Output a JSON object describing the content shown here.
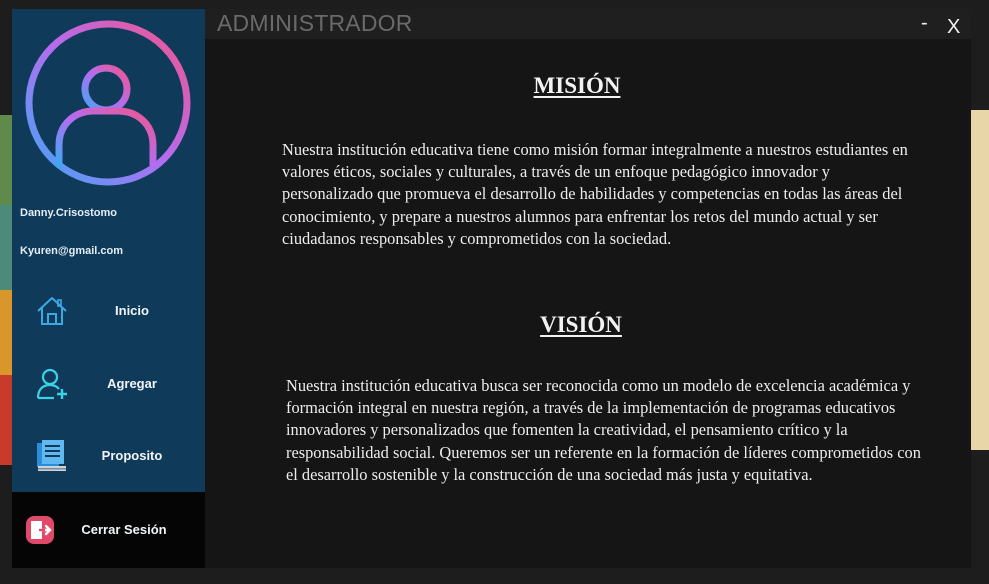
{
  "window": {
    "title": "ADMINISTRADOR",
    "minimize_label": "-",
    "close_label": "X"
  },
  "user": {
    "name": "Danny.Crisostomo",
    "email": "Kyuren@gmail.com"
  },
  "nav": {
    "items": [
      {
        "label": "Inicio",
        "icon": "home-icon"
      },
      {
        "label": "Agregar",
        "icon": "add-user-icon"
      },
      {
        "label": "Proposito",
        "icon": "document-icon"
      }
    ],
    "logout": {
      "label": "Cerrar Sesión",
      "icon": "logout-icon"
    }
  },
  "content": {
    "mision_title": "MISIÓN",
    "mision_text": "Nuestra institución educativa tiene como misión formar integralmente a nuestros estudiantes en valores éticos, sociales y culturales, a través de un enfoque pedagógico innovador y personalizado que promueva el desarrollo de habilidades y competencias en todas las áreas del conocimiento, y prepare a nuestros alumnos para enfrentar los retos del mundo actual y ser ciudadanos responsables y comprometidos con la sociedad.",
    "vision_title": "VISIÓN",
    "vision_text": "Nuestra institución educativa busca ser reconocida como un modelo de excelencia académica y formación integral en nuestra región, a través de la implementación de programas educativos innovadores y personalizados que fomenten la creatividad, el pensamiento crítico y la responsabilidad social. Queremos ser un referente en la formación de líderes comprometidos con el desarrollo sostenible y la construcción de una sociedad más justa y equitativa."
  },
  "colors": {
    "sidebar": "#0f3a5a",
    "logout_bg": "#050505",
    "content_bg": "#151515",
    "avatar_gradient_start": "#f0568c",
    "avatar_gradient_mid": "#b46cf0",
    "avatar_gradient_end": "#3fa8f5"
  }
}
